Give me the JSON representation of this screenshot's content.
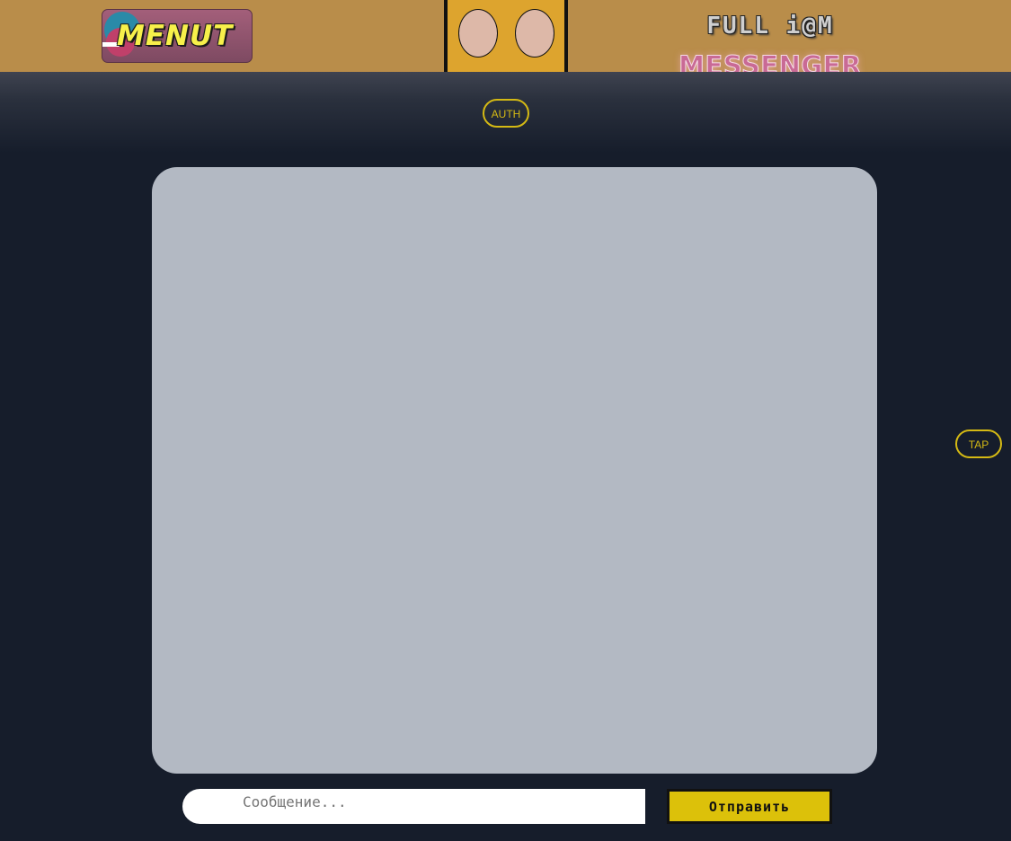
{
  "header": {
    "menu_label": "MENUT",
    "title_top": "FULL i@M",
    "title_bottom": "MESSENGER"
  },
  "buttons": {
    "auth": "AUTH",
    "tap": "TAP",
    "send": "Отправить"
  },
  "composer": {
    "placeholder": "Сообщение...",
    "value": ""
  },
  "colors": {
    "header_bg": "#b98d4a",
    "page_bg": "#161d2b",
    "panel_bg": "#dda42e",
    "accent_yellow": "#d4b914",
    "chat_bg": "#b3b9c3"
  }
}
